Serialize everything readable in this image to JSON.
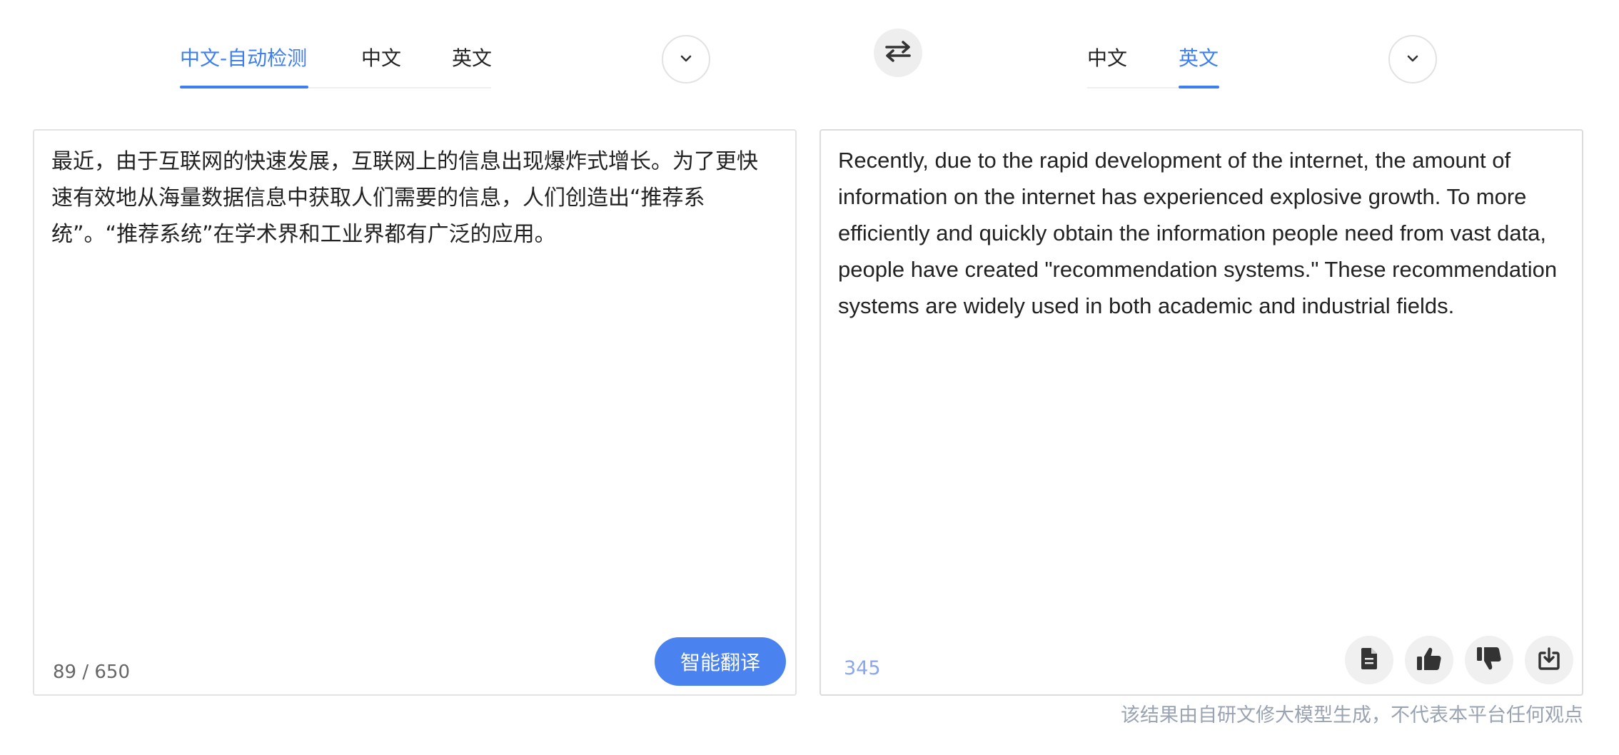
{
  "source_tabs": [
    {
      "label": "中文-自动检测",
      "active": true
    },
    {
      "label": "中文",
      "active": false
    },
    {
      "label": "英文",
      "active": false
    }
  ],
  "target_tabs": [
    {
      "label": "中文",
      "active": false
    },
    {
      "label": "英文",
      "active": true
    }
  ],
  "source": {
    "text": "最近，由于互联网的快速发展，互联网上的信息出现爆炸式增长。为了更快速有效地从海量数据信息中获取人们需要的信息，人们创造出“推荐系统”。“推荐系统”在学术界和工业界都有广泛的应用。",
    "counter": "89 / 650",
    "translate_label": "智能翻译"
  },
  "output": {
    "text": "Recently, due to the rapid development of the internet, the amount of information on the internet has experienced explosive growth. To more efficiently and quickly obtain the information people need from vast data, people have created \"recommendation systems.\" These recommendation systems are widely used in both academic and industrial fields.",
    "count": "345"
  },
  "disclaimer": "该结果由自研文修大模型生成，不代表本平台任何观点",
  "icons": {
    "source_dropdown": "chevron-down-icon",
    "target_dropdown": "chevron-down-icon",
    "swap": "swap-arrows-icon",
    "copy": "document-icon",
    "like": "thumbs-up-icon",
    "dislike": "thumbs-down-icon",
    "download": "download-icon"
  },
  "colors": {
    "accent": "#3d7ef0",
    "button": "#4a82ef",
    "muted_count": "#8aa6ec",
    "disclaimer": "#9aa3b2"
  }
}
